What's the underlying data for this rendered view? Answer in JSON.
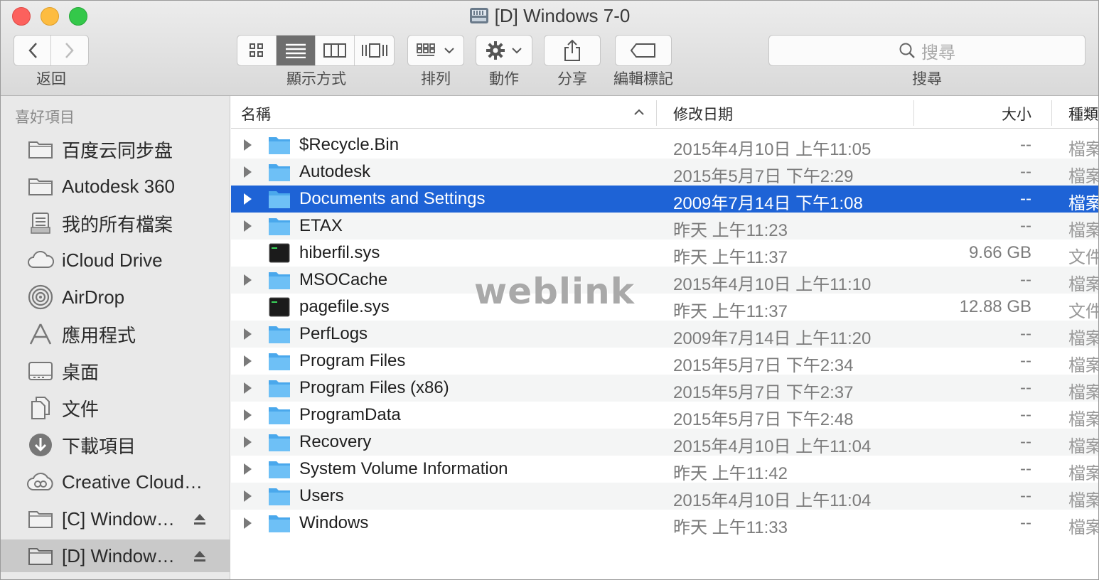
{
  "window": {
    "title": "[D] Windows 7-0"
  },
  "toolbar": {
    "back_label": "返回",
    "view_label": "顯示方式",
    "sort_label": "排列",
    "action_label": "動作",
    "share_label": "分享",
    "tags_label": "編輯標記",
    "search_placeholder": "搜尋",
    "search_label": "搜尋"
  },
  "sidebar": {
    "heading": "喜好項目",
    "items": [
      {
        "label": "百度云同步盘",
        "icon": "folder-icon"
      },
      {
        "label": "Autodesk 360",
        "icon": "folder-icon"
      },
      {
        "label": "我的所有檔案",
        "icon": "all-files-icon"
      },
      {
        "label": "iCloud Drive",
        "icon": "cloud-icon"
      },
      {
        "label": "AirDrop",
        "icon": "airdrop-icon"
      },
      {
        "label": "應用程式",
        "icon": "applications-icon"
      },
      {
        "label": "桌面",
        "icon": "desktop-icon"
      },
      {
        "label": "文件",
        "icon": "documents-icon"
      },
      {
        "label": "下載項目",
        "icon": "downloads-icon"
      },
      {
        "label": "Creative Cloud…",
        "icon": "creative-cloud-icon"
      },
      {
        "label": "[C] Window…",
        "icon": "drive-icon",
        "eject": true
      },
      {
        "label": "[D] Window…",
        "icon": "drive-icon",
        "eject": true,
        "selected": true
      }
    ]
  },
  "columns": {
    "name": "名稱",
    "date": "修改日期",
    "size": "大小",
    "kind": "種類"
  },
  "files": [
    {
      "name": "$Recycle.Bin",
      "date": "2015年4月10日 上午11:05",
      "size": "--",
      "kind": "檔案",
      "type": "folder"
    },
    {
      "name": "Autodesk",
      "date": "2015年5月7日 下午2:29",
      "size": "--",
      "kind": "檔案",
      "type": "folder"
    },
    {
      "name": "Documents and Settings",
      "date": "2009年7月14日 下午1:08",
      "size": "--",
      "kind": "檔案",
      "type": "folder",
      "selected": true
    },
    {
      "name": "ETAX",
      "date": "昨天 上午11:23",
      "size": "--",
      "kind": "檔案",
      "type": "folder"
    },
    {
      "name": "hiberfil.sys",
      "date": "昨天 上午11:37",
      "size": "9.66 GB",
      "kind": "文件",
      "type": "exec"
    },
    {
      "name": "MSOCache",
      "date": "2015年4月10日 上午11:10",
      "size": "--",
      "kind": "檔案",
      "type": "folder"
    },
    {
      "name": "pagefile.sys",
      "date": "昨天 上午11:37",
      "size": "12.88 GB",
      "kind": "文件",
      "type": "exec"
    },
    {
      "name": "PerfLogs",
      "date": "2009年7月14日 上午11:20",
      "size": "--",
      "kind": "檔案",
      "type": "folder"
    },
    {
      "name": "Program Files",
      "date": "2015年5月7日 下午2:34",
      "size": "--",
      "kind": "檔案",
      "type": "folder"
    },
    {
      "name": "Program Files (x86)",
      "date": "2015年5月7日 下午2:37",
      "size": "--",
      "kind": "檔案",
      "type": "folder"
    },
    {
      "name": "ProgramData",
      "date": "2015年5月7日 下午2:48",
      "size": "--",
      "kind": "檔案",
      "type": "folder"
    },
    {
      "name": "Recovery",
      "date": "2015年4月10日 上午11:04",
      "size": "--",
      "kind": "檔案",
      "type": "folder"
    },
    {
      "name": "System Volume Information",
      "date": "昨天 上午11:42",
      "size": "--",
      "kind": "檔案",
      "type": "folder"
    },
    {
      "name": "Users",
      "date": "2015年4月10日 上午11:04",
      "size": "--",
      "kind": "檔案",
      "type": "folder"
    },
    {
      "name": "Windows",
      "date": "昨天 上午11:33",
      "size": "--",
      "kind": "檔案",
      "type": "folder"
    }
  ],
  "watermark": "weblink",
  "colors": {
    "selection": "#1e63d6",
    "folder": "#5ab4f0",
    "sidebar_bg": "#e9e9e9"
  }
}
